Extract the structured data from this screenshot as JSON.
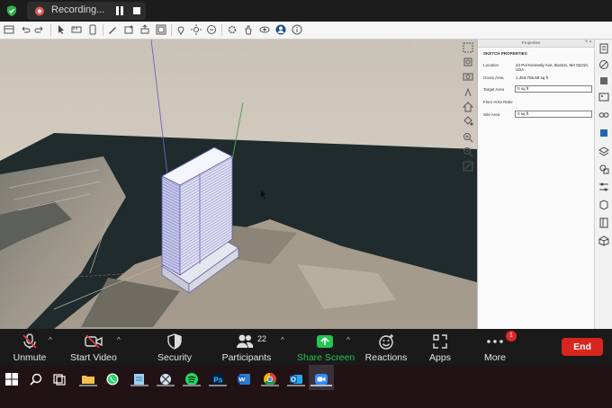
{
  "recording": {
    "label": "Recording...",
    "shield_icon": "shield-check-icon",
    "colors": {
      "shield": "#2fb14d",
      "cloud": "#e25757"
    }
  },
  "properties": {
    "panel_title": "Properties",
    "section": "SKETCH PROPERTIES",
    "location_label": "Location",
    "location_value": "24 Pol Kennedy Ave, Boston, MA 02210, USA",
    "gross_area_label": "Gross Area",
    "gross_area_value": "1,464,755.68 sq ft",
    "target_area_label": "Target Area",
    "target_area_value": "0 sq ft",
    "far_label": "Floor Area Ratio",
    "site_area_label": "Site Area",
    "site_area_value": "0 sq ft"
  },
  "zoom": {
    "unmute": "Unmute",
    "start_video": "Start Video",
    "security": "Security",
    "participants": "Participants",
    "participants_count": "22",
    "share_screen": "Share Screen",
    "reactions": "Reactions",
    "apps": "Apps",
    "more": "More",
    "more_badge": "1",
    "end": "End",
    "colors": {
      "share": "#23c552",
      "end": "#d7261d",
      "badge": "#e02828"
    }
  },
  "toolbar_icons": [
    "file-icon",
    "undo-icon",
    "redo-icon",
    "select-icon",
    "eraser-icon",
    "tape-icon",
    "paint-icon",
    "pencil-icon",
    "shape-icon",
    "pushpull-icon",
    "offset-icon",
    "move-icon",
    "rotate-icon",
    "scale-icon",
    "orbit-icon",
    "pan-icon",
    "zoom-icon",
    "section-icon",
    "settings-icon",
    "info-icon"
  ],
  "taskbar_icons": [
    "windows-start-icon",
    "search-icon",
    "task-view-icon",
    "file-explorer-icon",
    "whatsapp-icon",
    "notepad-icon",
    "snipping-tool-icon",
    "spotify-icon",
    "photoshop-icon",
    "word-icon",
    "chrome-icon",
    "outlook-icon",
    "zoom-app-icon"
  ]
}
